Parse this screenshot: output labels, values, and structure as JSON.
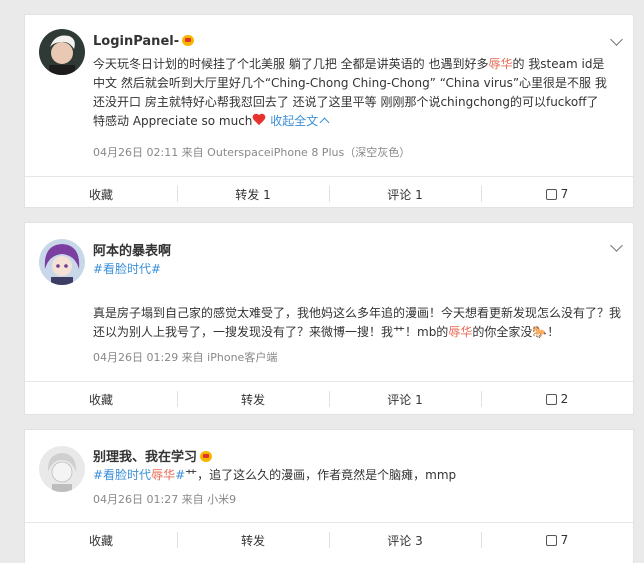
{
  "posts": [
    {
      "username": "LoginPanel-",
      "text_parts": [
        "今天玩冬日计划的时候挂了个北美服 躺了几把 全都是讲英语的 也遇到好多",
        "辱华",
        "的 我steam id是中文 然后就会听到大厅里好几个“Ching-Chong Ching-Chong” “China virus”心里很是不服 我还没开口 房主就特好心帮我怼回去了 还说了这里平等 刚刚那个说chingchong的可以fuckoff了 特感动 Appreciate so much"
      ],
      "collapse_label": "收起全文",
      "meta": "04月26日 02:11  来自 OuterspaceiPhone 8 Plus（深空灰色）",
      "actions": {
        "favorite": "收藏",
        "repost": "转发 1",
        "comment": "评论 1",
        "like": "7"
      }
    },
    {
      "username": "阿本的暴表啊",
      "topic": "#看脸时代#",
      "text_parts": [
        "真是房子塌到自己家的感觉太难受了，我他妈这么多年追的漫画！今天想看更新发现怎么没有了？我还以为别人上我号了，一搜发现没有了？来微博一搜！我艹！mb的",
        "辱华",
        "的你全家没"
      ],
      "end_mark": "！",
      "meta": "04月26日 01:29  来自 iPhone客户端",
      "actions": {
        "favorite": "收藏",
        "repost": "转发",
        "comment": "评论 1",
        "like": "2"
      }
    },
    {
      "username": "别理我、我在学习",
      "topic_parts": [
        "#看脸时代",
        "辱华",
        "#"
      ],
      "text": "艹，追了这么久的漫画，作者竟然是个脑瘫，mmp",
      "meta": "04月26日 01:27  来自 小米9",
      "actions": {
        "favorite": "收藏",
        "repost": "转发",
        "comment": "评论 3",
        "like": "7"
      }
    }
  ]
}
